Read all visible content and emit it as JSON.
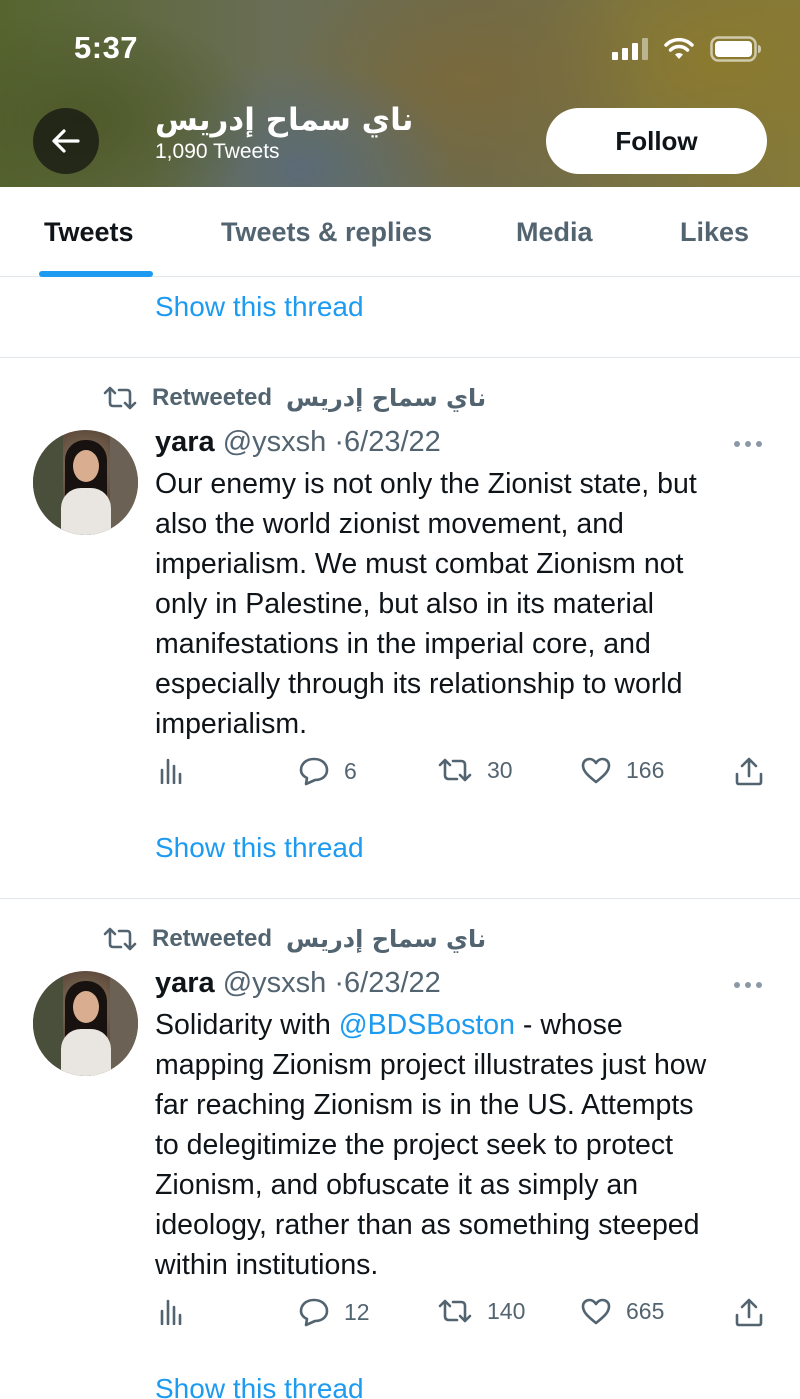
{
  "status_bar": {
    "time": "5:37"
  },
  "header": {
    "profile_name": "ناي سماح إدريس",
    "tweet_count": "1,090 Tweets",
    "follow_label": "Follow"
  },
  "tabs": [
    {
      "label": "Tweets",
      "active": true
    },
    {
      "label": "Tweets & replies",
      "active": false
    },
    {
      "label": "Media",
      "active": false
    },
    {
      "label": "Likes",
      "active": false
    }
  ],
  "top_thread_link": "Show this thread",
  "tweets": [
    {
      "retweet_label": "Retweeted",
      "retweeter": "ناي سماح إدريس",
      "author_name": "yara",
      "handle": "@ysxsh",
      "separator": "·",
      "date": "6/23/22",
      "lines": [
        "Our enemy is not only the Zionist state, but",
        "also the world zionist movement, and",
        "imperialism. We must combat Zionism not",
        "only in Palestine, but also in its material",
        "manifestations in the imperial core, and",
        "especially through its relationship to world",
        "imperialism."
      ],
      "replies": "6",
      "retweets": "30",
      "likes": "166",
      "thread_link": "Show this thread"
    },
    {
      "retweet_label": "Retweeted",
      "retweeter": "ناي سماح إدريس",
      "author_name": "yara",
      "handle": "@ysxsh",
      "separator": "·",
      "date": "6/23/22",
      "line1_before": "Solidarity with ",
      "mention": "@BDSBoston",
      "line1_after": " - whose",
      "lines": [
        "mapping Zionism project illustrates just how",
        "far reaching Zionism is in the US. Attempts",
        "to delegitimize the project seek to protect",
        "Zionism, and obfuscate it as simply an",
        "ideology, rather than as something steeped",
        "within institutions."
      ],
      "replies": "12",
      "retweets": "140",
      "likes": "665",
      "thread_link": "Show this thread"
    }
  ],
  "colors": {
    "accent": "#1d9bf0",
    "text_primary": "#0f1419",
    "text_secondary": "#536471",
    "divider": "#e1e6ea"
  },
  "icons": [
    "back-arrow-icon",
    "cellular-signal-icon",
    "wifi-icon",
    "battery-icon",
    "retweet-icon",
    "more-icon",
    "analytics-icon",
    "reply-icon",
    "like-icon",
    "share-icon"
  ]
}
